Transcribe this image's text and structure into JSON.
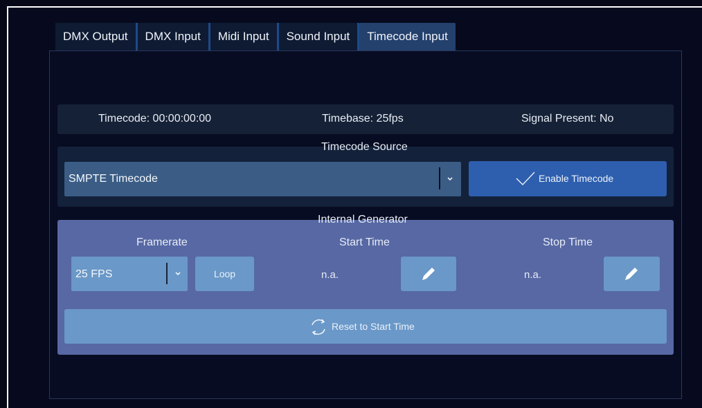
{
  "tabs": [
    {
      "label": "DMX Output"
    },
    {
      "label": "DMX Input"
    },
    {
      "label": "Midi Input"
    },
    {
      "label": "Sound Input"
    },
    {
      "label": "Timecode Input",
      "active": true
    }
  ],
  "status": {
    "timecode": "Timecode: 00:00:00:00",
    "timebase": "Timebase: 25fps",
    "signal": "Signal Present: No"
  },
  "source": {
    "title": "Timecode Source",
    "selected": "SMPTE Timecode",
    "enable_label": "Enable Timecode"
  },
  "generator": {
    "title": "Internal Generator",
    "framerate_label": "Framerate",
    "framerate_value": "25 FPS",
    "loop_label": "Loop",
    "start_label": "Start Time",
    "start_value": "n.a.",
    "stop_label": "Stop Time",
    "stop_value": "n.a.",
    "reset_label": "Reset to Start Time"
  },
  "icons": {
    "check": "check-icon",
    "chevron": "chevron-down-icon",
    "pencil": "pencil-icon",
    "reset": "refresh-icon"
  },
  "colors": {
    "accent": "#2e5fae",
    "generator_bg": "#5768a4",
    "button_light": "#6a98c8"
  }
}
